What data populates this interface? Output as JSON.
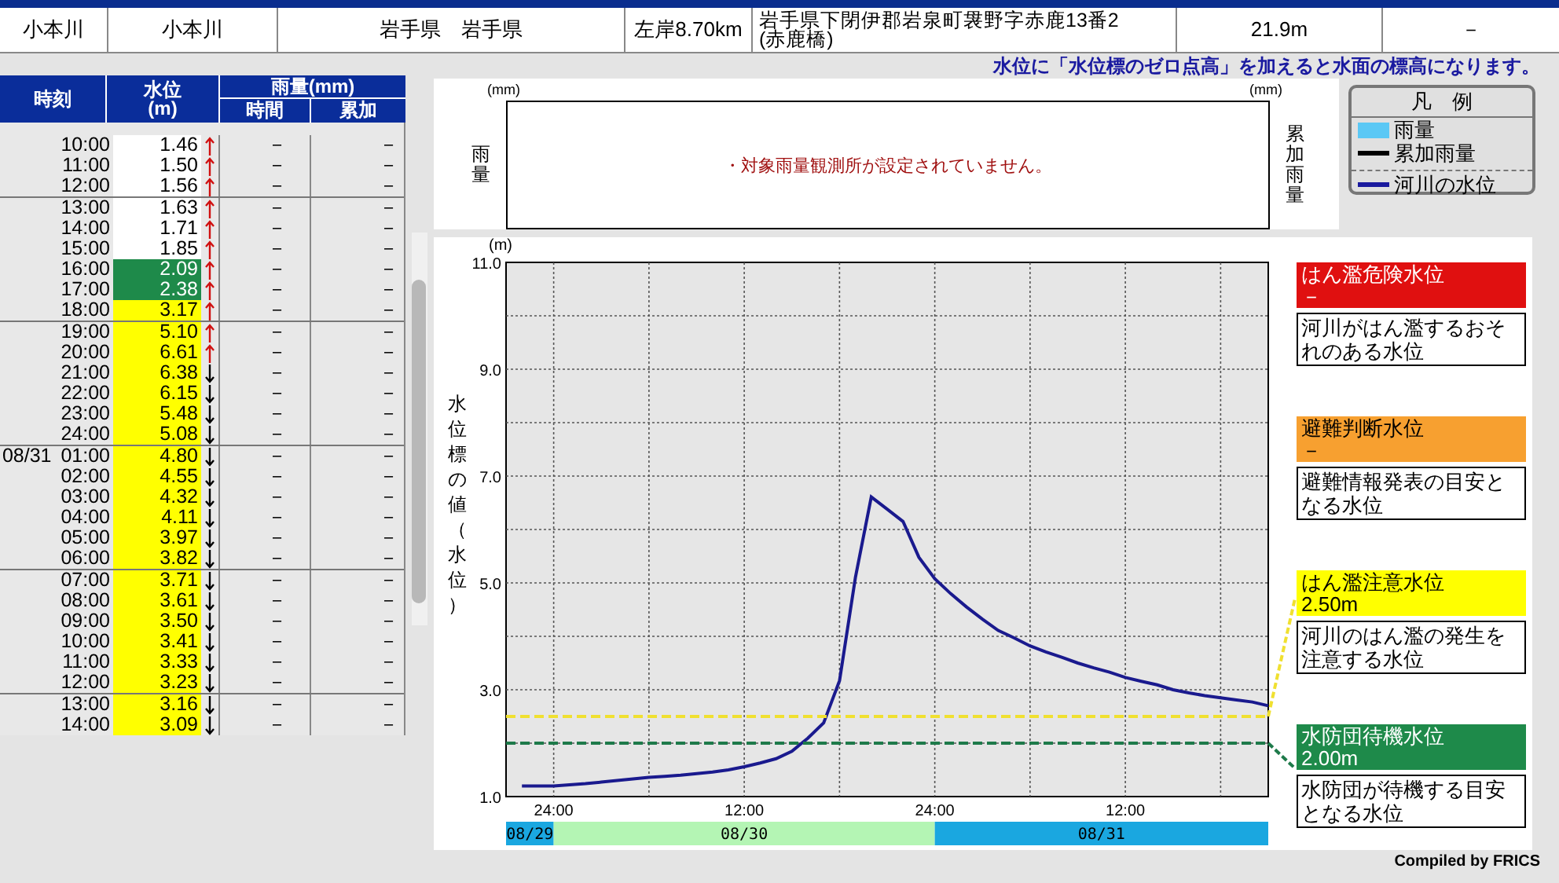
{
  "station_row": {
    "cells": [
      "小本川",
      "小本川",
      "岩手県　岩手県",
      "左岸8.70km",
      "岩手県下閉伊郡岩泉町袰野字赤鹿13番2\n(赤鹿橋)",
      "21.9m",
      "－"
    ]
  },
  "note": "水位に「水位標のゼロ点高」を加えると水面の標高になります。",
  "table": {
    "headers": {
      "time": "時刻",
      "level": "水位",
      "level_unit": "(m)",
      "rain": "雨量(mm)",
      "rain_hour": "時間",
      "rain_total": "累加"
    },
    "groups": [
      {
        "rows": [
          {
            "time": "10:00",
            "level": "1.46",
            "rising": true,
            "color": "#ffffff",
            "rain_hour": "－",
            "rain_total": "－"
          },
          {
            "time": "11:00",
            "level": "1.50",
            "rising": true,
            "color": "#ffffff",
            "rain_hour": "－",
            "rain_total": "－"
          },
          {
            "time": "12:00",
            "level": "1.56",
            "rising": true,
            "color": "#ffffff",
            "rain_hour": "－",
            "rain_total": "－"
          }
        ]
      },
      {
        "rows": [
          {
            "time": "13:00",
            "level": "1.63",
            "rising": true,
            "color": "#ffffff",
            "rain_hour": "－",
            "rain_total": "－"
          },
          {
            "time": "14:00",
            "level": "1.71",
            "rising": true,
            "color": "#ffffff",
            "rain_hour": "－",
            "rain_total": "－"
          },
          {
            "time": "15:00",
            "level": "1.85",
            "rising": true,
            "color": "#ffffff",
            "rain_hour": "－",
            "rain_total": "－"
          },
          {
            "time": "16:00",
            "level": "2.09",
            "rising": true,
            "color": "#1e8a4a",
            "rain_hour": "－",
            "rain_total": "－"
          },
          {
            "time": "17:00",
            "level": "2.38",
            "rising": true,
            "color": "#1e8a4a",
            "rain_hour": "－",
            "rain_total": "－"
          },
          {
            "time": "18:00",
            "level": "3.17",
            "rising": true,
            "color": "#ffff00",
            "rain_hour": "－",
            "rain_total": "－"
          }
        ]
      },
      {
        "rows": [
          {
            "time": "19:00",
            "level": "5.10",
            "rising": true,
            "color": "#ffff00",
            "rain_hour": "－",
            "rain_total": "－"
          },
          {
            "time": "20:00",
            "level": "6.61",
            "rising": true,
            "color": "#ffff00",
            "rain_hour": "－",
            "rain_total": "－"
          },
          {
            "time": "21:00",
            "level": "6.38",
            "rising": false,
            "color": "#ffff00",
            "rain_hour": "－",
            "rain_total": "－"
          },
          {
            "time": "22:00",
            "level": "6.15",
            "rising": false,
            "color": "#ffff00",
            "rain_hour": "－",
            "rain_total": "－"
          },
          {
            "time": "23:00",
            "level": "5.48",
            "rising": false,
            "color": "#ffff00",
            "rain_hour": "－",
            "rain_total": "－"
          },
          {
            "time": "24:00",
            "level": "5.08",
            "rising": false,
            "color": "#ffff00",
            "rain_hour": "－",
            "rain_total": "－"
          }
        ]
      },
      {
        "rows": [
          {
            "date": "08/31",
            "time": "01:00",
            "level": "4.80",
            "rising": false,
            "color": "#ffff00",
            "rain_hour": "－",
            "rain_total": "－"
          },
          {
            "time": "02:00",
            "level": "4.55",
            "rising": false,
            "color": "#ffff00",
            "rain_hour": "－",
            "rain_total": "－"
          },
          {
            "time": "03:00",
            "level": "4.32",
            "rising": false,
            "color": "#ffff00",
            "rain_hour": "－",
            "rain_total": "－"
          },
          {
            "time": "04:00",
            "level": "4.11",
            "rising": false,
            "color": "#ffff00",
            "rain_hour": "－",
            "rain_total": "－"
          },
          {
            "time": "05:00",
            "level": "3.97",
            "rising": false,
            "color": "#ffff00",
            "rain_hour": "－",
            "rain_total": "－"
          },
          {
            "time": "06:00",
            "level": "3.82",
            "rising": false,
            "color": "#ffff00",
            "rain_hour": "－",
            "rain_total": "－"
          }
        ]
      },
      {
        "rows": [
          {
            "time": "07:00",
            "level": "3.71",
            "rising": false,
            "color": "#ffff00",
            "rain_hour": "－",
            "rain_total": "－"
          },
          {
            "time": "08:00",
            "level": "3.61",
            "rising": false,
            "color": "#ffff00",
            "rain_hour": "－",
            "rain_total": "－"
          },
          {
            "time": "09:00",
            "level": "3.50",
            "rising": false,
            "color": "#ffff00",
            "rain_hour": "－",
            "rain_total": "－"
          },
          {
            "time": "10:00",
            "level": "3.41",
            "rising": false,
            "color": "#ffff00",
            "rain_hour": "－",
            "rain_total": "－"
          },
          {
            "time": "11:00",
            "level": "3.33",
            "rising": false,
            "color": "#ffff00",
            "rain_hour": "－",
            "rain_total": "－"
          },
          {
            "time": "12:00",
            "level": "3.23",
            "rising": false,
            "color": "#ffff00",
            "rain_hour": "－",
            "rain_total": "－"
          }
        ]
      },
      {
        "rows": [
          {
            "time": "13:00",
            "level": "3.16",
            "rising": false,
            "color": "#ffff00",
            "rain_hour": "－",
            "rain_total": "－"
          },
          {
            "time": "14:00",
            "level": "3.09",
            "rising": false,
            "color": "#ffff00",
            "rain_hour": "－",
            "rain_total": "－"
          }
        ]
      }
    ]
  },
  "rain_panel": {
    "unit_left": "(mm)",
    "unit_right": "(mm)",
    "left_label": "雨量",
    "right_label": "累加雨量",
    "message": "・対象雨量観測所が設定されていません。"
  },
  "legend": {
    "title": "凡　例",
    "items": [
      {
        "kind": "bar",
        "label": "雨量",
        "color": "#5bc8f5"
      },
      {
        "kind": "line",
        "label": "累加雨量",
        "color": "#000000"
      },
      {
        "kind": "line",
        "label": "河川の水位",
        "color": "#1a1a9e"
      }
    ]
  },
  "level_chart": {
    "unit": "(m)",
    "chart_data": {
      "type": "line",
      "ylabel": "水位標の値（水位）",
      "categories": [
        null,
        null,
        null,
        "24:00",
        null,
        null,
        null,
        null,
        null,
        null,
        null,
        null,
        null,
        null,
        null,
        "12:00",
        null,
        null,
        null,
        null,
        null,
        null,
        null,
        null,
        null,
        null,
        null,
        "24:00",
        null,
        null,
        null,
        null,
        null,
        null,
        null,
        null,
        null,
        null,
        null,
        "12:00",
        null,
        null,
        null,
        null,
        null,
        null,
        null,
        null,
        null
      ],
      "grid": true,
      "series": [
        {
          "line_style": "solid",
          "color": "#1a1a8e",
          "values": [
            null,
            1.2,
            1.2,
            1.2,
            1.22,
            1.24,
            1.27,
            1.3,
            1.33,
            1.36,
            1.38,
            1.4,
            1.43,
            1.46,
            1.5,
            1.56,
            1.63,
            1.71,
            1.85,
            2.09,
            2.38,
            3.17,
            5.1,
            6.61,
            6.38,
            6.15,
            5.48,
            5.08,
            4.8,
            4.55,
            4.32,
            4.11,
            3.97,
            3.82,
            3.71,
            3.61,
            3.5,
            3.41,
            3.33,
            3.23,
            3.16,
            3.09,
            3.0,
            2.94,
            2.89,
            2.85,
            2.81,
            2.77,
            2.7
          ]
        },
        {
          "line_style": "dashed",
          "color": "#f0e030",
          "values": [
            2.5,
            2.5,
            2.5,
            2.5,
            2.5,
            2.5,
            2.5,
            2.5,
            2.5,
            2.5,
            2.5,
            2.5,
            2.5,
            2.5,
            2.5,
            2.5,
            2.5,
            2.5,
            2.5,
            2.5,
            2.5,
            2.5,
            2.5,
            2.5,
            2.5,
            2.5,
            2.5,
            2.5,
            2.5,
            2.5,
            2.5,
            2.5,
            2.5,
            2.5,
            2.5,
            2.5,
            2.5,
            2.5,
            2.5,
            2.5,
            2.5,
            2.5,
            2.5,
            2.5,
            2.5,
            2.5,
            2.5,
            2.5,
            2.5
          ]
        },
        {
          "line_style": "dashed",
          "color": "#1e7a4a",
          "values": [
            2.0,
            2.0,
            2.0,
            2.0,
            2.0,
            2.0,
            2.0,
            2.0,
            2.0,
            2.0,
            2.0,
            2.0,
            2.0,
            2.0,
            2.0,
            2.0,
            2.0,
            2.0,
            2.0,
            2.0,
            2.0,
            2.0,
            2.0,
            2.0,
            2.0,
            2.0,
            2.0,
            2.0,
            2.0,
            2.0,
            2.0,
            2.0,
            2.0,
            2.0,
            2.0,
            2.0,
            2.0,
            2.0,
            2.0,
            2.0,
            2.0,
            2.0,
            2.0,
            2.0,
            2.0,
            2.0,
            2.0,
            2.0,
            2.0
          ]
        }
      ],
      "ylim": [
        1,
        11
      ],
      "yticks": [
        {
          "value": 1,
          "label": "1.0"
        },
        {
          "value": 3,
          "label": "3.0"
        },
        {
          "value": 5,
          "label": "5.0"
        },
        {
          "value": 7,
          "label": "7.0"
        },
        {
          "value": 9,
          "label": "9.0"
        },
        {
          "value": 11,
          "label": "11.0"
        }
      ]
    },
    "date_bands": [
      {
        "label": "08/29",
        "color": "#1aa7e0"
      },
      {
        "label": "08/30",
        "color": "#b4f5b4"
      },
      {
        "label": "08/31",
        "color": "#1aa7e0"
      }
    ]
  },
  "thresholds": [
    {
      "name": "はん濫危険水位",
      "value": "－",
      "color": "#e01010",
      "description": "河川がはん濫するおそれのある水位"
    },
    {
      "name": "避難判断水位",
      "value": "－",
      "color": "#f7a030",
      "description": "避難情報発表の目安となる水位"
    },
    {
      "name": "はん濫注意水位",
      "value": "2.50m",
      "color": "#ffff00",
      "description": "河川のはん濫の発生を注意する水位"
    },
    {
      "name": "水防団待機水位",
      "value": "2.00m",
      "color": "#1e8a4a",
      "description": "水防団が待機する目安となる水位"
    }
  ],
  "footer": "Compiled by FRICS"
}
